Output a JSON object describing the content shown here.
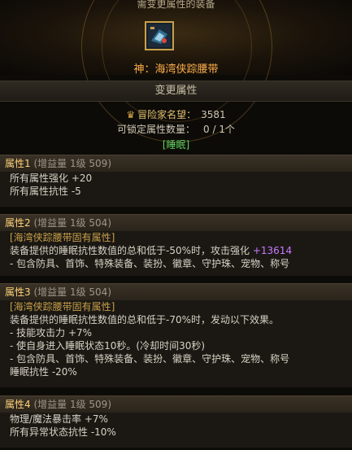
{
  "header": {
    "title": "需变更属性的装备",
    "item_icon": "belt-item-icon",
    "item_name": "神：海湾侠踪腰带"
  },
  "section": {
    "title": "变更属性",
    "fame_label": "冒险家名望：",
    "fame_value": "3581",
    "lock_label": "可锁定属性数量：",
    "lock_value": "0 / 1个",
    "tag": "[睡眠]"
  },
  "attributes": [
    {
      "title": "属性1",
      "meta": "(增益量 1级 509)",
      "lines": [
        "所有属性强化 +20",
        "所有属性抗性 -5"
      ]
    },
    {
      "title": "属性2",
      "meta": "(增益量 1级 504)",
      "bracket": "[海湾侠踪腰带固有属性]",
      "lines": [
        "装备提供的睡眠抗性数值的总和低于-50%时，攻击强化",
        "- 包含防具、首饰、特殊装备、装扮、徽章、守护珠、宠物、称号"
      ],
      "highlight": "+13614"
    },
    {
      "title": "属性3",
      "meta": "(增益量 1级 504)",
      "bracket": "[海湾侠踪腰带固有属性]",
      "lines": [
        "装备提供的睡眠抗性数值的总和低于-70%时，发动以下效果。",
        "- 技能攻击力 +7%",
        "- 使自身进入睡眠状态10秒。(冷却时间30秒)",
        "- 包含防具、首饰、特殊装备、装扮、徽章、守护珠、宠物、称号",
        "睡眠抗性 -20%"
      ]
    },
    {
      "title": "属性4",
      "meta": "(增益量 1级 509)",
      "lines": [
        "物理/魔法暴击率 +7%",
        "所有异常状态抗性 -10%"
      ]
    }
  ],
  "colors": {
    "gold": "#ffd27a",
    "orange": "#ffb04a",
    "green": "#5fd25f",
    "purple": "#c77aff"
  }
}
